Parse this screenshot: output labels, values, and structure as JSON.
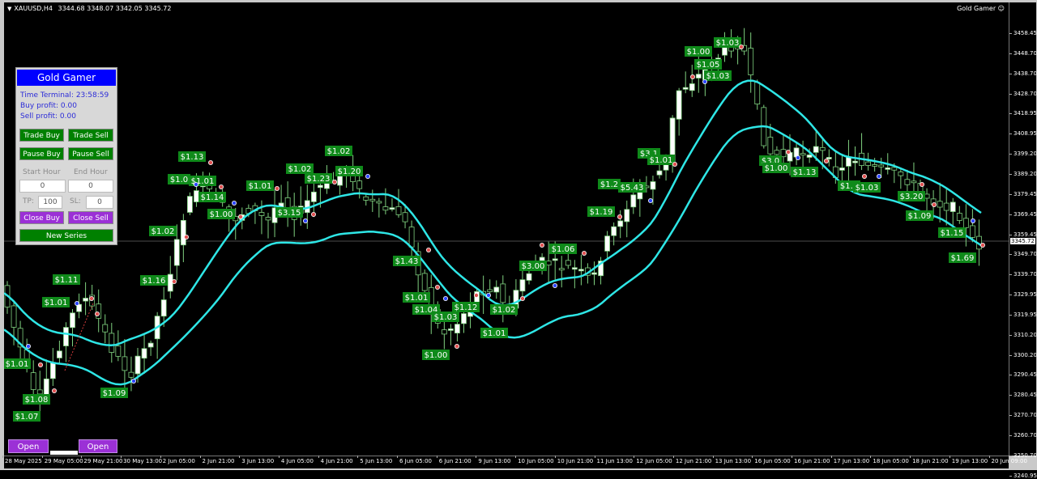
{
  "symbol": {
    "label": "XAUUSD,H4",
    "ohlc": "3344.68 3348.07 3342.05 3345.72"
  },
  "ea_name": "Gold Gamer",
  "ea_icon": "smiley-icon",
  "colors": {
    "bull_body": "#ffffff",
    "bear_body": "#000000",
    "wick": "#7fd07f",
    "ma": "#2ee6e6",
    "label_bg": "#0f8a1a",
    "button_green": "#008000",
    "button_purple": "#9b30d6",
    "panel_title": "#0000ff"
  },
  "y_axis": {
    "ticks": [
      "3458.45",
      "3448.70",
      "3438.70",
      "3428.70",
      "3418.95",
      "3408.95",
      "3399.20",
      "3389.20",
      "3379.45",
      "3369.45",
      "3359.45",
      "3349.70",
      "3339.70",
      "3329.95",
      "3319.95",
      "3310.20",
      "3300.20",
      "3290.45",
      "3280.45",
      "3270.70",
      "3260.70",
      "3250.70",
      "3240.95"
    ],
    "current_price": "3345.72"
  },
  "x_axis": {
    "ticks": [
      "28 May 2025",
      "29 May 05:00",
      "29 May 21:00",
      "30 May 13:00",
      "2 Jun 05:00",
      "2 Jun 21:00",
      "3 Jun 13:00",
      "4 Jun 05:00",
      "4 Jun 21:00",
      "5 Jun 13:00",
      "6 Jun 05:00",
      "6 Jun 21:00",
      "9 Jun 13:00",
      "10 Jun 05:00",
      "10 Jun 21:00",
      "11 Jun 13:00",
      "12 Jun 05:00",
      "12 Jun 21:00",
      "13 Jun 13:00",
      "16 Jun 05:00",
      "16 Jun 21:00",
      "17 Jun 13:00",
      "18 Jun 05:00",
      "18 Jun 21:00",
      "19 Jun 13:00",
      "20 Jun 09:00"
    ]
  },
  "panel": {
    "title": "Gold Gamer",
    "time_terminal": "Time Terminal: 23:58:59",
    "buy_profit": "Buy profit: 0.00",
    "sell_profit": "Sell profit: 0.00",
    "trade_buy": "Trade Buy",
    "trade_sell": "Trade Sell",
    "pause_buy": "Pause Buy",
    "pause_sell": "Pause Sell",
    "start_hour_label": "Start Hour",
    "end_hour_label": "End Hour",
    "start_hour_value": "0",
    "end_hour_value": "0",
    "tp_label": "TP:",
    "tp_value": "100",
    "sl_label": "SL:",
    "sl_value": "0",
    "close_buy": "Close Buy",
    "close_sell": "Close Sell",
    "new_series": "New Series"
  },
  "open_buy": "Open Buy",
  "open_sell": "Open Sell",
  "profit_labels": [
    "$1.01",
    "$1.08",
    "$1.07",
    "$1.11",
    "$1.01",
    "$1.09",
    "$1.16",
    "$1.02",
    "$1.13",
    "$1.0",
    "$1.01",
    "$1.14",
    "$1.00",
    "$1.01",
    "$3.15",
    "$1.02",
    "$1.23",
    "$1.02",
    "$1.20",
    "$1.43",
    "$1.01",
    "$1.04",
    "$1.03",
    "$1.00",
    "$1.12",
    "$1.02",
    "$1.01",
    "$3.00",
    "$1.06",
    "$1.19",
    "$1.2",
    "$5.43",
    "$3.1",
    "$1.01",
    "$1.00",
    "$1.05",
    "$1.03",
    "$1.03",
    "$3.0",
    "$1.00",
    "$1.13",
    "$1.1",
    "$1.03",
    "$3.20",
    "$1.09",
    "$1.15",
    "$1.69"
  ]
}
